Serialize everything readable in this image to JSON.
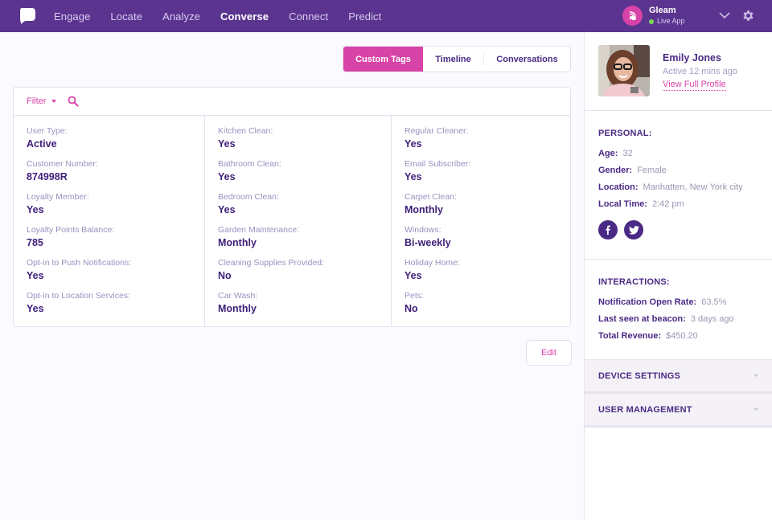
{
  "nav": {
    "items": [
      {
        "label": "Engage",
        "active": false
      },
      {
        "label": "Locate",
        "active": false
      },
      {
        "label": "Analyze",
        "active": false
      },
      {
        "label": "Converse",
        "active": true
      },
      {
        "label": "Connect",
        "active": false
      },
      {
        "label": "Predict",
        "active": false
      }
    ],
    "app": {
      "name": "Gleam",
      "status": "Live App",
      "status_color": "#7ed957"
    }
  },
  "tabs": [
    {
      "label": "Custom Tags",
      "active": true
    },
    {
      "label": "Timeline",
      "active": false
    },
    {
      "label": "Conversations",
      "active": false
    }
  ],
  "filter": {
    "label": "Filter"
  },
  "tags": {
    "columns": [
      [
        {
          "label": "User Type:",
          "value": "Active"
        },
        {
          "label": "Customer Number:",
          "value": "874998R"
        },
        {
          "label": "Loyalty Member:",
          "value": "Yes"
        },
        {
          "label": "Loyalty Points Balance:",
          "value": "785"
        },
        {
          "label": "Opt-in to Push Notifications:",
          "value": "Yes"
        },
        {
          "label": "Opt-in to Location Services:",
          "value": "Yes"
        }
      ],
      [
        {
          "label": "Kitchen Clean:",
          "value": "Yes"
        },
        {
          "label": "Bathroom Clean:",
          "value": "Yes"
        },
        {
          "label": "Bedroom Clean:",
          "value": "Yes"
        },
        {
          "label": "Garden Maintenance:",
          "value": "Monthly"
        },
        {
          "label": "Cleaning Supplies Provided:",
          "value": "No"
        },
        {
          "label": "Car Wash:",
          "value": "Monthly"
        }
      ],
      [
        {
          "label": "Regular Cleaner:",
          "value": "Yes"
        },
        {
          "label": "Email Subscriber:",
          "value": "Yes"
        },
        {
          "label": "Carpet Clean:",
          "value": "Monthly"
        },
        {
          "label": "Windows:",
          "value": "Bi-weekly"
        },
        {
          "label": "Holiday Home:",
          "value": "Yes"
        },
        {
          "label": "Pets:",
          "value": "No"
        }
      ]
    ]
  },
  "edit_label": "Edit",
  "profile": {
    "name": "Emily Jones",
    "active": "Active 12 mins ago",
    "link": "View Full Profile"
  },
  "personal": {
    "title": "PERSONAL:",
    "rows": [
      {
        "k": "Age:",
        "v": "32"
      },
      {
        "k": "Gender:",
        "v": "Female"
      },
      {
        "k": "Location:",
        "v": "Manhatten, New York city"
      },
      {
        "k": "Local Time:",
        "v": "2:42 pm"
      }
    ]
  },
  "interactions": {
    "title": "INTERACTIONS:",
    "rows": [
      {
        "k": "Notification Open Rate:",
        "v": "63.5%"
      },
      {
        "k": "Last seen at beacon:",
        "v": "3 days ago"
      },
      {
        "k": "Total Revenue:",
        "v": "$450.20"
      }
    ]
  },
  "accordions": [
    {
      "label": "DEVICE SETTINGS"
    },
    {
      "label": "USER MANAGEMENT"
    }
  ],
  "colors": {
    "nav_bg": "#5b3490",
    "accent": "#d843a7",
    "primary_text": "#4a2a85"
  }
}
